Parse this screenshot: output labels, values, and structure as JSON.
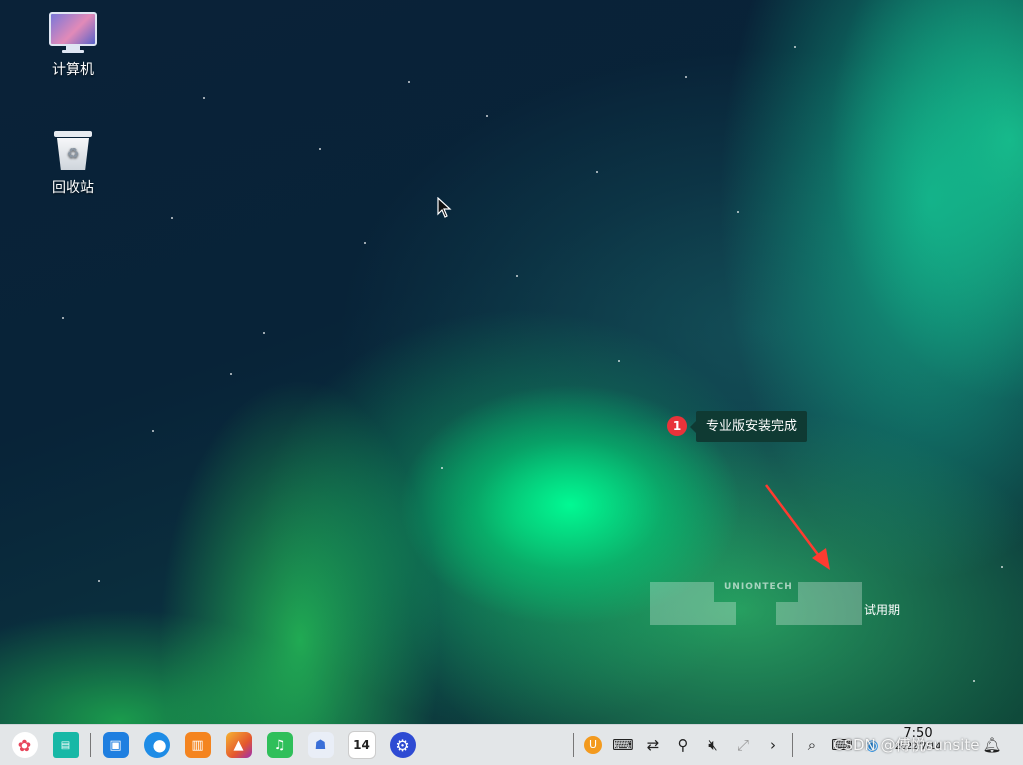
{
  "desktop": {
    "icons": [
      {
        "label": "计算机",
        "icon": "computer-icon"
      },
      {
        "label": "回收站",
        "icon": "trash-icon"
      }
    ],
    "notification": {
      "badge": "1",
      "text": "专业版安装完成"
    },
    "watermark": {
      "brand": "UNIONTECH",
      "trial_label": "试用期"
    }
  },
  "taskbar": {
    "apps": [
      {
        "name": "launcher",
        "icon": "launcher-icon"
      },
      {
        "name": "show-desktop",
        "icon": "show-desktop-icon"
      },
      {
        "name": "app-store",
        "icon": "app-store-icon"
      },
      {
        "name": "browser",
        "icon": "browser-icon"
      },
      {
        "name": "file-manager",
        "icon": "file-manager-icon"
      },
      {
        "name": "image-viewer",
        "icon": "image-viewer-icon"
      },
      {
        "name": "music",
        "icon": "music-icon"
      },
      {
        "name": "contacts",
        "icon": "contacts-icon"
      },
      {
        "name": "calendar",
        "icon": "calendar-icon",
        "text": "14"
      },
      {
        "name": "settings",
        "icon": "settings-icon"
      }
    ],
    "tray": [
      "input-method-icon",
      "keyboard-icon",
      "network-icon",
      "usb-icon",
      "volume-muted-icon",
      "vpn-icon",
      "expand-icon",
      "search-icon",
      "keyboard-layout-icon",
      "browser-tray-icon",
      "notification-icon"
    ],
    "clock": {
      "time": "7:50",
      "date": "2022/7/14"
    }
  },
  "overlay": {
    "csdn_watermark": "CSDN @傅悦sunsite"
  },
  "colors": {
    "badge": "#e8333a",
    "tooltip_bg": "#0f3a33",
    "taskbar_bg": "#eceef0"
  }
}
